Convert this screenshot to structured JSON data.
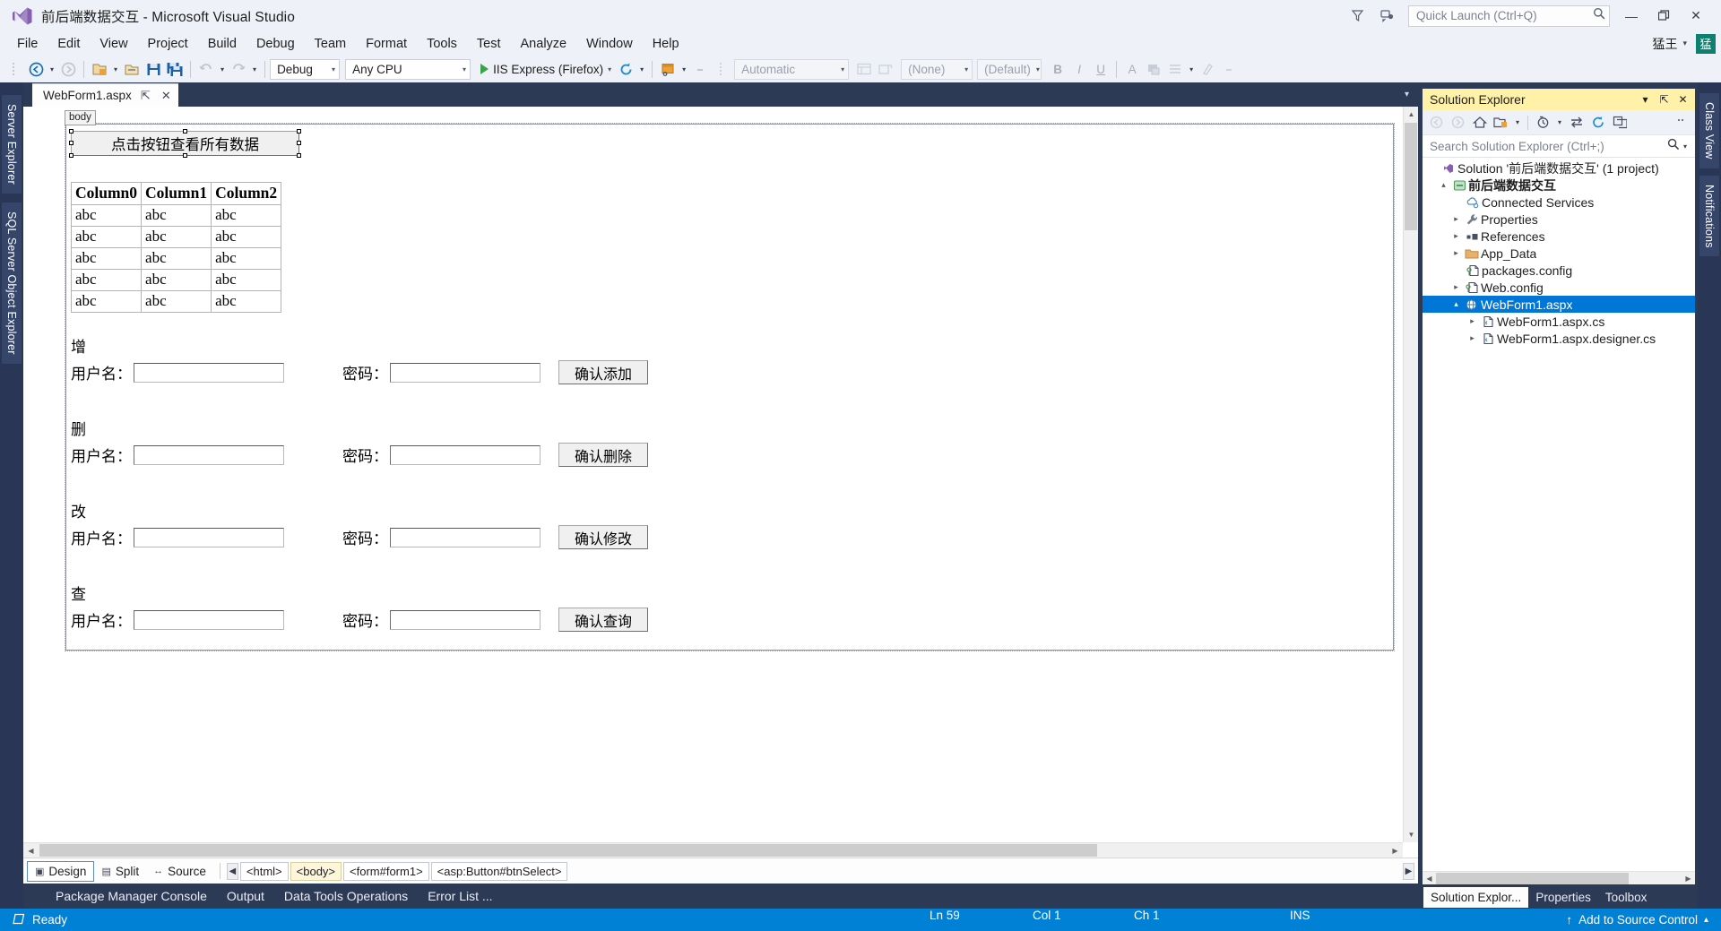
{
  "titlebar": {
    "project_title": "前后端数据交互 - Microsoft Visual Studio",
    "quick_launch_placeholder": "Quick Launch (Ctrl+Q)",
    "user_name": "猛王",
    "avatar_initial": "猛",
    "minimize": "—",
    "restore": "❐",
    "close": "✕"
  },
  "menubar": {
    "items": [
      {
        "label": "File"
      },
      {
        "label": "Edit"
      },
      {
        "label": "View"
      },
      {
        "label": "Project"
      },
      {
        "label": "Build"
      },
      {
        "label": "Debug"
      },
      {
        "label": "Team"
      },
      {
        "label": "Format"
      },
      {
        "label": "Tools"
      },
      {
        "label": "Test"
      },
      {
        "label": "Analyze"
      },
      {
        "label": "Window"
      },
      {
        "label": "Help"
      }
    ]
  },
  "toolbar": {
    "config_value": "Debug",
    "platform_value": "Any CPU",
    "run_target": "IIS Express (Firefox)",
    "automatic_value": "Automatic",
    "none_value": "(None)",
    "default_value": "(Default)",
    "bold": "B",
    "italic": "I",
    "underline": "U",
    "font_color": "A"
  },
  "left_dock": {
    "tabs": [
      {
        "label": "Server Explorer"
      },
      {
        "label": "SQL Server Object Explorer"
      }
    ]
  },
  "right_dock_tabs": {
    "tabs": [
      {
        "label": "Class View"
      },
      {
        "label": "Notifications"
      }
    ]
  },
  "editor": {
    "tab_name": "WebForm1.aspx",
    "pin_glyph": "⇱",
    "close_glyph": "✕",
    "body_chip": "body"
  },
  "design": {
    "select_button_label": "点击按钮查看所有数据",
    "grid": {
      "headers": [
        "Column0",
        "Column1",
        "Column2"
      ],
      "rows": [
        [
          "abc",
          "abc",
          "abc"
        ],
        [
          "abc",
          "abc",
          "abc"
        ],
        [
          "abc",
          "abc",
          "abc"
        ],
        [
          "abc",
          "abc",
          "abc"
        ],
        [
          "abc",
          "abc",
          "abc"
        ]
      ]
    },
    "username_label": "用户名：",
    "password_label": "密码：",
    "sections": [
      {
        "title": "增",
        "button": "确认添加"
      },
      {
        "title": "删",
        "button": "确认删除"
      },
      {
        "title": "改",
        "button": "确认修改"
      },
      {
        "title": "查",
        "button": "确认查询"
      }
    ]
  },
  "viewbar": {
    "design_label": "Design",
    "split_label": "Split",
    "source_label": "Source",
    "breadcrumb": [
      {
        "label": "<html>",
        "highlight": false
      },
      {
        "label": "<body>",
        "highlight": true
      },
      {
        "label": "<form#form1>",
        "highlight": false
      },
      {
        "label": "<asp:Button#btnSelect>",
        "highlight": false
      }
    ]
  },
  "bottom_panels": {
    "tabs": [
      {
        "label": "Package Manager Console"
      },
      {
        "label": "Output"
      },
      {
        "label": "Data Tools Operations"
      },
      {
        "label": "Error List ..."
      }
    ]
  },
  "solution_explorer": {
    "title": "Solution Explorer",
    "dropdown_glyph": "▾",
    "pin_glyph": "⇱",
    "close_glyph": "✕",
    "search_placeholder": "Search Solution Explorer (Ctrl+;)",
    "tree": [
      {
        "label": "Solution '前后端数据交互' (1 project)",
        "indent": 0,
        "twisty": "",
        "icon": "solution-icon",
        "selected": false
      },
      {
        "label": "前后端数据交互",
        "indent": 1,
        "twisty": "▴",
        "icon": "project-icon",
        "selected": false,
        "bold": true
      },
      {
        "label": "Connected Services",
        "indent": 2,
        "twisty": "",
        "icon": "connected-services-icon",
        "selected": false
      },
      {
        "label": "Properties",
        "indent": 2,
        "twisty": "▸",
        "icon": "wrench-icon",
        "selected": false
      },
      {
        "label": "References",
        "indent": 2,
        "twisty": "▸",
        "icon": "references-icon",
        "selected": false
      },
      {
        "label": "App_Data",
        "indent": 2,
        "twisty": "▸",
        "icon": "folder-icon",
        "selected": false
      },
      {
        "label": "packages.config",
        "indent": 2,
        "twisty": "",
        "icon": "config-file-icon",
        "selected": false
      },
      {
        "label": "Web.config",
        "indent": 2,
        "twisty": "▸",
        "icon": "config-file-icon",
        "selected": false
      },
      {
        "label": "WebForm1.aspx",
        "indent": 2,
        "twisty": "▴",
        "icon": "web-form-icon",
        "selected": true
      },
      {
        "label": "WebForm1.aspx.cs",
        "indent": 3,
        "twisty": "▸",
        "icon": "code-file-icon",
        "selected": false
      },
      {
        "label": "WebForm1.aspx.designer.cs",
        "indent": 3,
        "twisty": "▸",
        "icon": "code-file-icon",
        "selected": false
      }
    ],
    "bottom_tabs": [
      {
        "label": "Solution Explor...",
        "active": true
      },
      {
        "label": "Properties",
        "active": false
      },
      {
        "label": "Toolbox",
        "active": false
      }
    ]
  },
  "statusbar": {
    "state": "Ready",
    "line": "Ln 59",
    "col": "Col 1",
    "ch": "Ch 1",
    "ins": "INS",
    "source_control": "Add to Source Control",
    "source_control_caret": "▴",
    "source_control_arrow": "↑"
  },
  "colors": {
    "accent_blue": "#0081d6",
    "selection_blue": "#0076d7",
    "header_yellow": "#fff2a8",
    "dock_navy": "#2d3a56",
    "chrome_gray": "#eef1f7"
  }
}
